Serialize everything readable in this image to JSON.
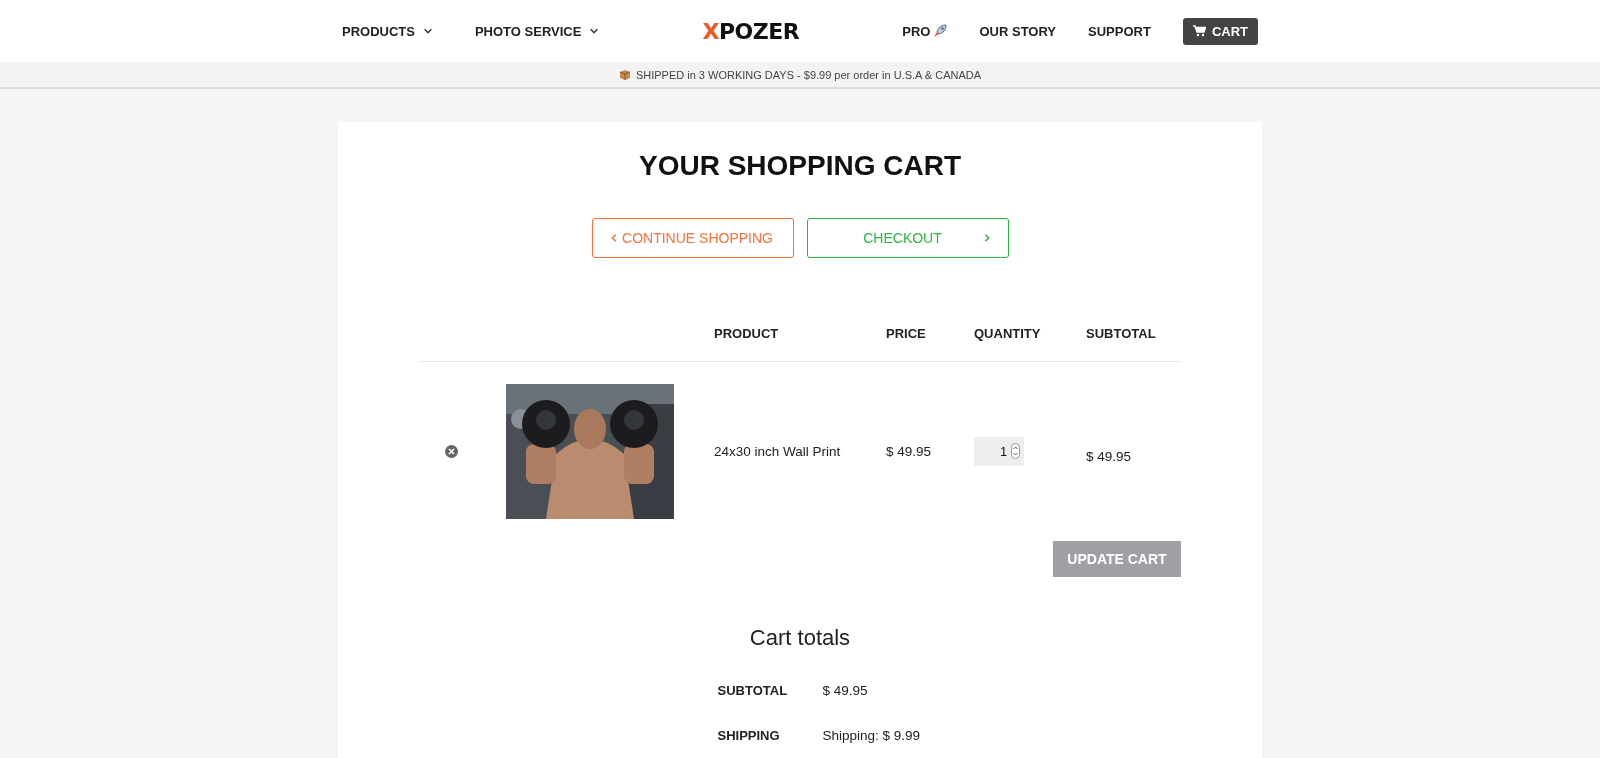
{
  "nav": {
    "left": [
      {
        "label": "PRODUCTS",
        "dropdown": true
      },
      {
        "label": "PHOTO SERVICE",
        "dropdown": true
      }
    ],
    "logo": {
      "first": "X",
      "rest": "POZER"
    },
    "right": [
      {
        "label": "PRO",
        "kind": "rocket"
      },
      {
        "label": "OUR STORY",
        "kind": "plain"
      },
      {
        "label": "SUPPORT",
        "kind": "plain"
      }
    ],
    "cart": "CART"
  },
  "banner": "SHIPPED in 3 WORKING DAYS - $9.99 per order in U.S.A & CANADA",
  "title": "YOUR SHOPPING CART",
  "actions": [
    {
      "label": "CONTINUE SHOPPING",
      "kind": "back"
    },
    {
      "label": "CHECKOUT",
      "kind": "forward"
    }
  ],
  "table": {
    "columns": [
      "PRODUCT",
      "PRICE",
      "QUANTITY",
      "SUBTOTAL"
    ],
    "rows": [
      {
        "product": "24x30 inch Wall Print",
        "price": "$ 49.95",
        "quantity": "1",
        "subtotal": "$ 49.95"
      }
    ]
  },
  "update_button": "UPDATE CART",
  "totals": {
    "title": "Cart totals",
    "rows": [
      {
        "label": "SUBTOTAL",
        "value": "$ 49.95"
      },
      {
        "label": "SHIPPING",
        "value": "Shipping: $ 9.99"
      }
    ]
  }
}
